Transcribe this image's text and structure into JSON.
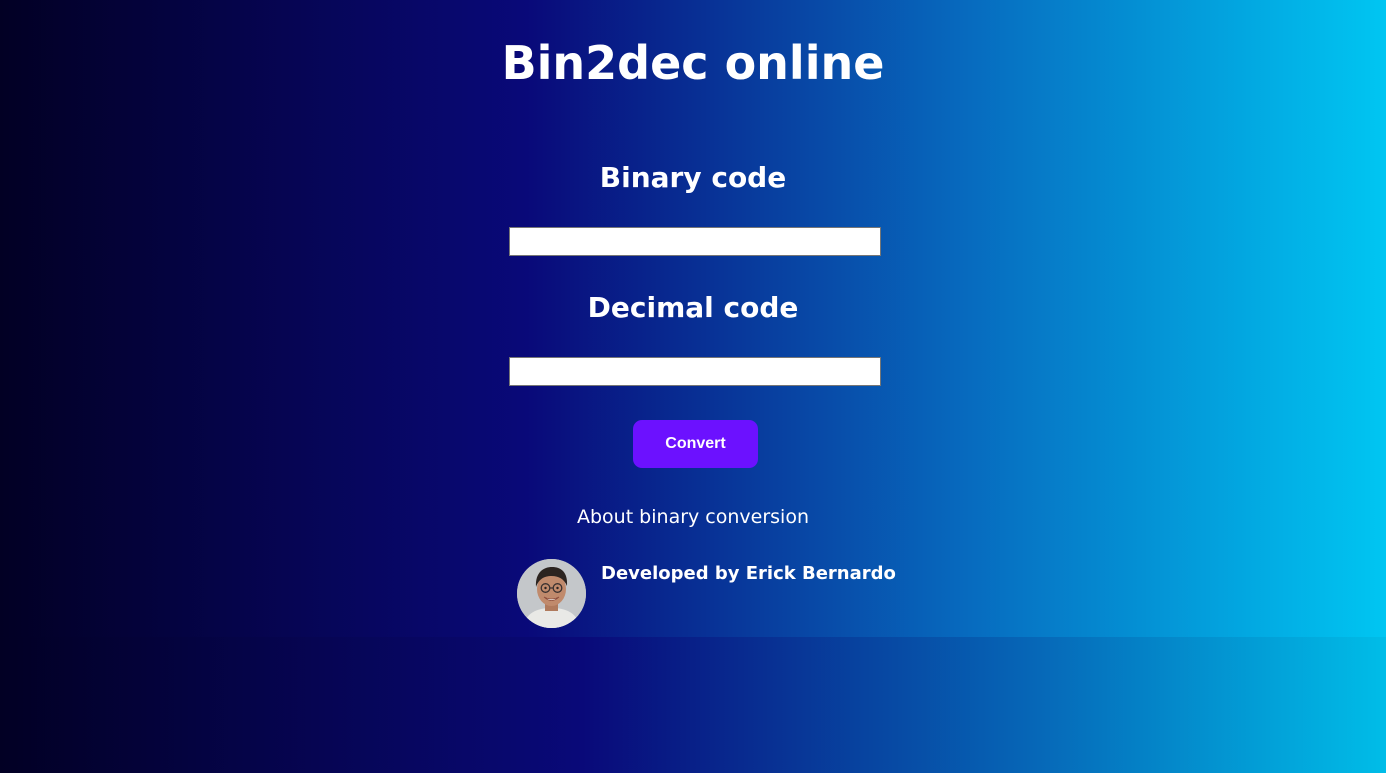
{
  "header": {
    "title": "Bin2dec online"
  },
  "form": {
    "binary_label": "Binary code",
    "binary_value": "",
    "decimal_label": "Decimal code",
    "decimal_value": "",
    "convert_label": "Convert"
  },
  "footer": {
    "about_link": "About binary conversion",
    "credit": "Developed by Erick Bernardo",
    "avatar_icon": "developer-avatar-photo"
  },
  "colors": {
    "gradient_start": "#020024",
    "gradient_mid": "#090979",
    "gradient_end": "#00c6f2",
    "button": "#6c11ff",
    "text": "#ffffff"
  }
}
